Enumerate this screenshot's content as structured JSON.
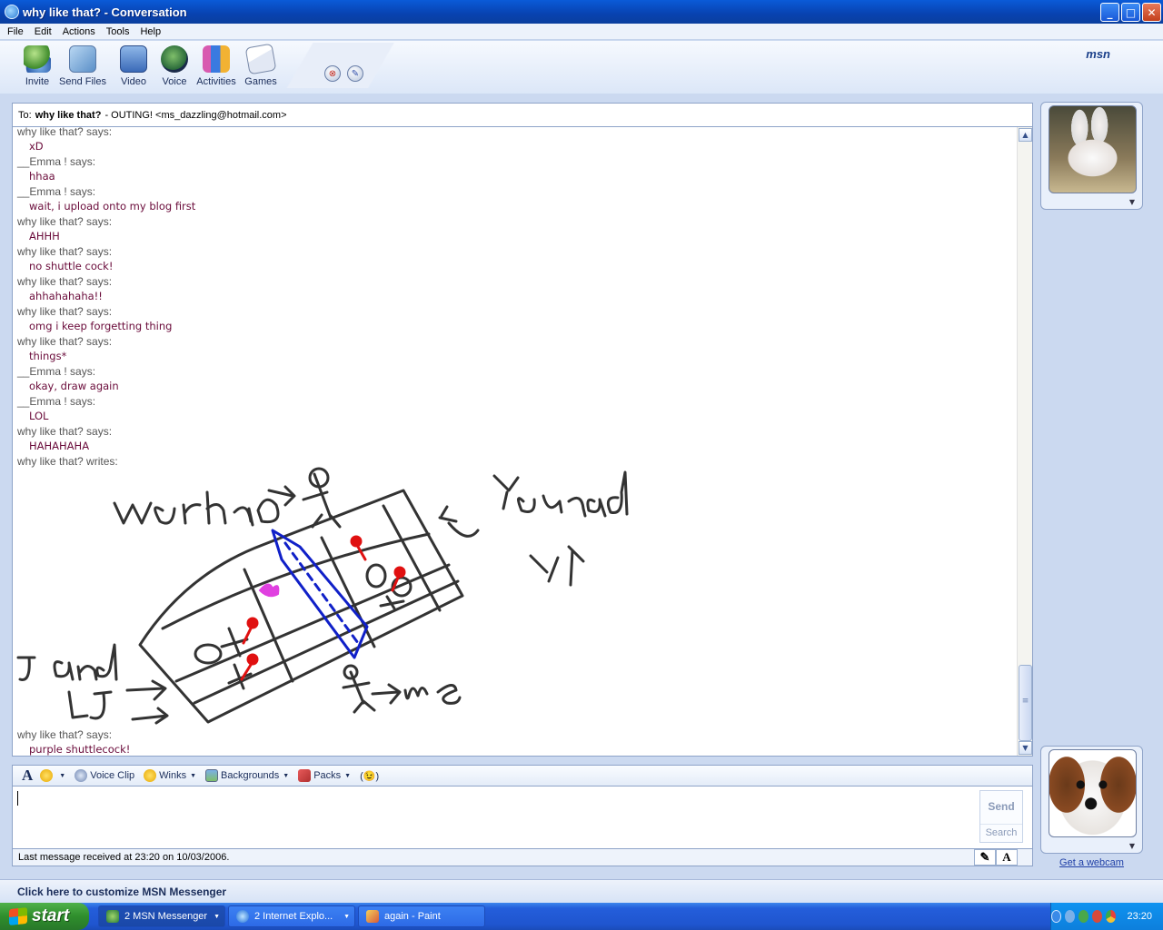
{
  "window": {
    "title": "why like that? - Conversation",
    "controls": {
      "minimize": "_",
      "maximize": "□",
      "close": "✕"
    }
  },
  "menu": [
    "File",
    "Edit",
    "Actions",
    "Tools",
    "Help"
  ],
  "toolbar": {
    "items": [
      {
        "label": "Invite",
        "icon": "invite-icon"
      },
      {
        "label": "Send Files",
        "icon": "send-files-icon"
      },
      {
        "label": "Video",
        "icon": "video-icon"
      },
      {
        "label": "Voice",
        "icon": "voice-icon"
      },
      {
        "label": "Activities",
        "icon": "activities-icon"
      },
      {
        "label": "Games",
        "icon": "games-icon"
      }
    ],
    "block_glyph": "⊗",
    "edit_glyph": "✎",
    "logo": "msn"
  },
  "to": {
    "prefix": "To:",
    "name": "why like that?",
    "status": "- OUTING! <ms_dazzling@hotmail.com>"
  },
  "messages": [
    {
      "head": "why like that? says:",
      "text": "xD"
    },
    {
      "head": "__Emma ! says:",
      "text": "hhaa"
    },
    {
      "head": "__Emma ! says:",
      "text": "wait, i upload onto my blog first"
    },
    {
      "head": "why like that? says:",
      "text": "AHHH"
    },
    {
      "head": "why like that? says:",
      "text": "no shuttle cock!"
    },
    {
      "head": "why like that? says:",
      "text": "ahhahahaha!!"
    },
    {
      "head": "why like that? says:",
      "text": "omg i keep forgetting thing"
    },
    {
      "head": "why like that? says:",
      "text": "things*"
    },
    {
      "head": "__Emma ! says:",
      "text": "okay, draw again"
    },
    {
      "head": "__Emma ! says:",
      "text": "LOL"
    },
    {
      "head": "why like that? says:",
      "text": "HAHAHAHA"
    }
  ],
  "writes_head": "why like that? writes:",
  "ink_labels": {
    "top_left": "weihao",
    "top_right": "Youand",
    "right": "YY",
    "left1": "J and",
    "left2": "LJ",
    "bottom": "me"
  },
  "last_message": {
    "head": "why like that? says:",
    "text": "purple shuttlecock!"
  },
  "scroll": {
    "up": "▲",
    "down": "▼",
    "grip": "≡"
  },
  "format_bar": {
    "font_glyph": "A",
    "items": [
      {
        "label": "",
        "icon": "emoticon-icon"
      },
      {
        "label": "Voice Clip",
        "icon": "voice-clip-icon"
      },
      {
        "label": "Winks",
        "icon": "winks-icon"
      },
      {
        "label": "Backgrounds",
        "icon": "backgrounds-icon"
      },
      {
        "label": "Packs",
        "icon": "packs-icon"
      }
    ],
    "nudge": "(😉)"
  },
  "input": {
    "send": "Send",
    "search": "Search"
  },
  "status_line": "Last message received at 23:20 on 10/03/2006.",
  "ink_mode_glyphs": [
    "✎",
    "A"
  ],
  "right_panel": {
    "webcam_link": "Get a webcam"
  },
  "customize": "Click here to customize MSN Messenger",
  "taskbar": {
    "start": "start",
    "tasks": [
      {
        "label": "2 MSN Messenger",
        "active": true
      },
      {
        "label": "2 Internet Explo...",
        "active": false
      },
      {
        "label": "again - Paint",
        "active": false
      }
    ],
    "clock": "23:20"
  },
  "colors": {
    "accent": "#0a5bd8",
    "message_text": "#6a0b3a",
    "ink_gray": "#333333",
    "ink_red": "#e01010",
    "ink_blue": "#1020c8",
    "ink_magenta": "#e020e0"
  }
}
